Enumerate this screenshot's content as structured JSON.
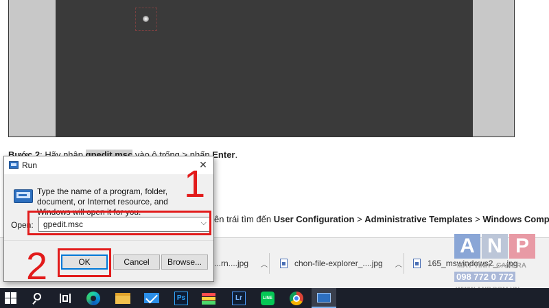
{
  "document": {
    "step_prefix": "Bước 2",
    "step_mid": ": Hãy nhập ",
    "step_command": "gpedit.msc",
    "step_mid2": " vào ô trống > nhấn ",
    "step_enter": "Enter",
    "step_end": ".",
    "line2_prefix": "ên trái tìm đến ",
    "line2_path1": "User Configuration",
    "line2_sep1": " > ",
    "line2_path2": "Administrative Templates",
    "line2_sep2": " > ",
    "line2_path3": "Windows Component"
  },
  "run_dialog": {
    "title": "Run",
    "close": "✕",
    "description": "Type the name of a program, folder, document, or Internet resource, and Windows will open it for you.",
    "open_label": "Open:",
    "input_value": "gpedit.msc",
    "ok_label": "OK",
    "cancel_label": "Cancel",
    "browse_label": "Browse..."
  },
  "annotations": {
    "step1": "1",
    "step2": "2",
    "color": "#e21b1b"
  },
  "download_bar": {
    "items": [
      {
        "name": "...rn....jpg"
      },
      {
        "name": "chon-file-explorer_....jpg"
      },
      {
        "name": "165_mswindows2_....jpg"
      }
    ]
  },
  "watermark": {
    "letters": [
      "A",
      "N",
      "P"
    ],
    "subtitle": "MÁY TÍNH - CAMERA",
    "phone": "098 772 0 772",
    "website": "WWW.ANP.COM.VN"
  },
  "taskbar": {
    "ps_label": "Ps",
    "lr_label": "Lr",
    "line_label": "LINE"
  }
}
